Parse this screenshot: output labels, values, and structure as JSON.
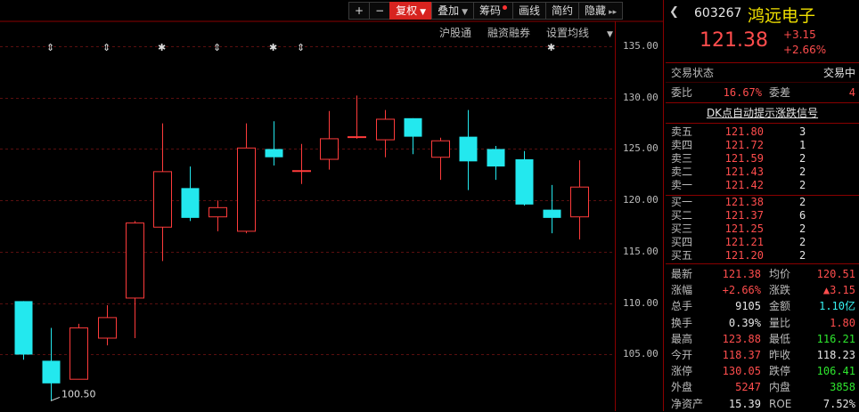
{
  "toolbar": {
    "plus_label": "+",
    "minus_label": "−",
    "fq_label": "复权",
    "overlay_label": "叠加",
    "chips_label": "筹码",
    "draw_label": "画线",
    "simple_label": "简约",
    "hide_label": "隐藏",
    "more_label": "▸▸"
  },
  "subbar": {
    "hgt_label": "沪股通",
    "margin_label": "融资融券",
    "ma_label": "设置均线"
  },
  "markers": [
    "⇕",
    "⇕",
    "✱",
    "⇕",
    "✱",
    "⇕",
    "✱"
  ],
  "chart_data": {
    "type": "candlestick",
    "y_ticks": [
      "135.00",
      "130.00",
      "125.00",
      "120.00",
      "115.00",
      "110.00",
      "105.00"
    ],
    "ylim": [
      99.5,
      139.5
    ],
    "low_annotation": "100.50",
    "candles": [
      {
        "o": 110.2,
        "c": 105.0,
        "h": 110.2,
        "l": 104.5
      },
      {
        "o": 104.4,
        "c": 102.2,
        "h": 107.6,
        "l": 100.5
      },
      {
        "o": 102.6,
        "c": 107.6,
        "h": 108.0,
        "l": 102.6
      },
      {
        "o": 106.6,
        "c": 108.6,
        "h": 109.8,
        "l": 105.9
      },
      {
        "o": 110.5,
        "c": 117.8,
        "h": 118.0,
        "l": 106.6
      },
      {
        "o": 117.4,
        "c": 122.8,
        "h": 127.5,
        "l": 114.1
      },
      {
        "o": 121.2,
        "c": 118.3,
        "h": 123.3,
        "l": 118.0
      },
      {
        "o": 118.4,
        "c": 119.3,
        "h": 120.0,
        "l": 117.0
      },
      {
        "o": 117.0,
        "c": 125.1,
        "h": 127.5,
        "l": 116.8
      },
      {
        "o": 125.0,
        "c": 124.2,
        "h": 127.7,
        "l": 123.4
      },
      {
        "o": 122.9,
        "c": 122.9,
        "h": 125.5,
        "l": 121.6
      },
      {
        "o": 124.0,
        "c": 126.0,
        "h": 128.7,
        "l": 123.0
      },
      {
        "o": 126.2,
        "c": 126.2,
        "h": 130.2,
        "l": 126.0
      },
      {
        "o": 125.9,
        "c": 127.9,
        "h": 128.8,
        "l": 124.2
      },
      {
        "o": 128.0,
        "c": 126.2,
        "h": 128.0,
        "l": 124.5
      },
      {
        "o": 124.2,
        "c": 125.8,
        "h": 126.1,
        "l": 122.0
      },
      {
        "o": 126.2,
        "c": 123.8,
        "h": 128.8,
        "l": 121.0
      },
      {
        "o": 125.0,
        "c": 123.3,
        "h": 125.3,
        "l": 122.0
      },
      {
        "o": 124.0,
        "c": 119.6,
        "h": 124.8,
        "l": 119.5
      },
      {
        "o": 119.1,
        "c": 118.3,
        "h": 121.5,
        "l": 116.8
      },
      {
        "o": 118.4,
        "c": 121.3,
        "h": 123.9,
        "l": 116.2
      }
    ],
    "colors": {
      "up": "#ff3b3b",
      "down": "#23e8ee",
      "grid": "#5a0f0f",
      "axis": "#8a0000"
    }
  },
  "panel": {
    "code": "603267",
    "name": "鸿远电子",
    "price": "121.38",
    "change": "+3.15",
    "change_pct": "+2.66%",
    "status_label": "交易状态",
    "status_value": "交易中",
    "wb_label": "委比",
    "wb_value": "16.67%",
    "wc_label": "委差",
    "wc_value": "4",
    "dk_link": "DK点自动提示涨跌信号",
    "sell": [
      {
        "label": "卖五",
        "price": "121.80",
        "vol": "3"
      },
      {
        "label": "卖四",
        "price": "121.72",
        "vol": "1"
      },
      {
        "label": "卖三",
        "price": "121.59",
        "vol": "2"
      },
      {
        "label": "卖二",
        "price": "121.43",
        "vol": "2"
      },
      {
        "label": "卖一",
        "price": "121.42",
        "vol": "2"
      }
    ],
    "buy": [
      {
        "label": "买一",
        "price": "121.38",
        "vol": "2"
      },
      {
        "label": "买二",
        "price": "121.37",
        "vol": "6"
      },
      {
        "label": "买三",
        "price": "121.25",
        "vol": "2"
      },
      {
        "label": "买四",
        "price": "121.21",
        "vol": "2"
      },
      {
        "label": "买五",
        "price": "121.20",
        "vol": "2"
      }
    ],
    "stats": [
      {
        "l1": "最新",
        "v1": "121.38",
        "c1": "red",
        "l2": "均价",
        "v2": "120.51",
        "c2": "red"
      },
      {
        "l1": "涨幅",
        "v1": "+2.66%",
        "c1": "red",
        "l2": "涨跌",
        "v2": "▲3.15",
        "c2": "red"
      },
      {
        "l1": "总手",
        "v1": "9105",
        "c1": "white",
        "l2": "金额",
        "v2": "1.10亿",
        "c2": "cyan"
      },
      {
        "l1": "换手",
        "v1": "0.39%",
        "c1": "white",
        "l2": "量比",
        "v2": "1.80",
        "c2": "red"
      },
      {
        "l1": "最高",
        "v1": "123.88",
        "c1": "red",
        "l2": "最低",
        "v2": "116.21",
        "c2": "green"
      },
      {
        "l1": "今开",
        "v1": "118.37",
        "c1": "red",
        "l2": "昨收",
        "v2": "118.23",
        "c2": "white"
      },
      {
        "l1": "涨停",
        "v1": "130.05",
        "c1": "red",
        "l2": "跌停",
        "v2": "106.41",
        "c2": "green"
      },
      {
        "l1": "外盘",
        "v1": "5247",
        "c1": "red",
        "l2": "内盘",
        "v2": "3858",
        "c2": "green"
      },
      {
        "l1": "净资产",
        "v1": "15.39",
        "c1": "white",
        "l2": "ROE",
        "v2": "7.52%",
        "c2": "white"
      }
    ]
  }
}
